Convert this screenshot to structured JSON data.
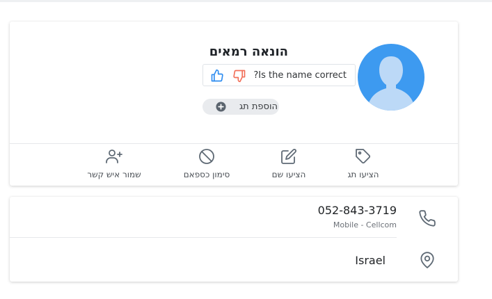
{
  "profile": {
    "name": "הונאה רמאים",
    "feedback_question": "?Is the name correct",
    "add_tag_label": "הוספת תג"
  },
  "actions": [
    {
      "label": "הציעו תג",
      "icon": "tag-icon"
    },
    {
      "label": "הציעו שם",
      "icon": "edit-icon"
    },
    {
      "label": "סימון כספאם",
      "icon": "block-icon"
    },
    {
      "label": "שמור איש קשר",
      "icon": "add-user-icon"
    }
  ],
  "details": {
    "phone": "052-843-3719",
    "phone_type": "Mobile - Cellcom",
    "country": "Israel"
  },
  "colors": {
    "avatar_bg": "#3d9af0",
    "thumb_up": "#2f8df0",
    "thumb_down": "#f2705a",
    "icon_gray": "#5f6a75"
  }
}
